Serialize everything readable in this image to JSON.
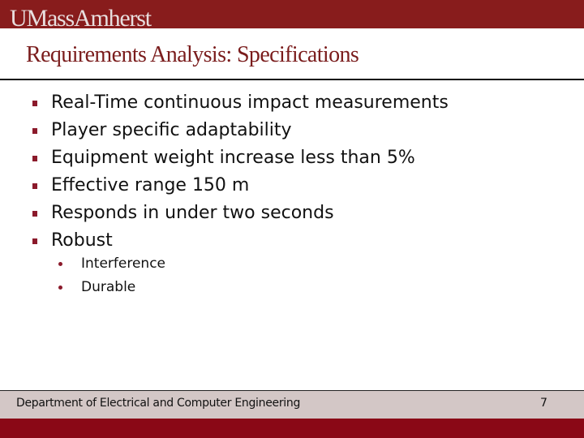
{
  "header": {
    "logo_text": "UMassAmherst",
    "brand_color": "#881c1c"
  },
  "slide": {
    "title": "Requirements Analysis: Specifications",
    "bullets": [
      {
        "text": "Real-Time continuous impact measurements"
      },
      {
        "text": "Player specific adaptability"
      },
      {
        "text": "Equipment weight increase less than 5%"
      },
      {
        "text": "Effective range 150 m"
      },
      {
        "text": "Responds in under two seconds"
      },
      {
        "text": "Robust"
      }
    ],
    "sub_bullets": [
      {
        "text": "Interference"
      },
      {
        "text": "Durable"
      }
    ]
  },
  "footer": {
    "department": "Department of Electrical and Computer Engineering",
    "page_number": "7"
  }
}
